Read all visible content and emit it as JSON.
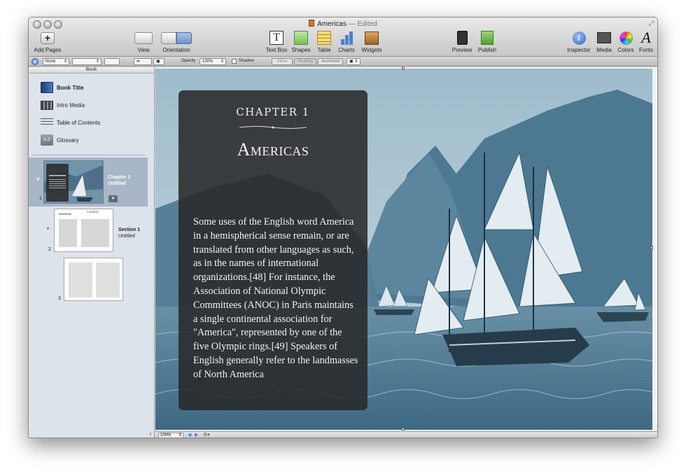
{
  "window": {
    "title": "Americas",
    "status": "— Edited"
  },
  "toolbar": {
    "add_pages": "Add Pages",
    "view": "View",
    "orientation": "Orientation",
    "text_box": "Text Box",
    "shapes": "Shapes",
    "table": "Table",
    "charts": "Charts",
    "widgets": "Widgets",
    "preview": "Preview",
    "publish": "Publish",
    "inspector": "Inspector",
    "media": "Media",
    "colors": "Colors",
    "fonts": "Fonts"
  },
  "format_bar": {
    "none_value": "None",
    "opacity_label": "Opacity",
    "opacity_value": "100%",
    "shadow_label": "Shadow",
    "inline": "Inline",
    "floating": "Floating",
    "anchored": "Anchored"
  },
  "sidebar": {
    "header": "Book",
    "items": [
      {
        "label": "Book Title",
        "icon": "book-icon"
      },
      {
        "label": "Intro Media",
        "icon": "film-icon"
      },
      {
        "label": "Table of Contents",
        "icon": "list-icon"
      },
      {
        "label": "Glossary",
        "icon": "az-icon",
        "icon_text": "A-Z"
      }
    ],
    "chapter": {
      "title": "Chapter 1",
      "subtitle": "Untitled",
      "number": "1"
    },
    "section": {
      "title": "Section 1",
      "subtitle": "Untitled",
      "number": "2",
      "thumb_title": "Untitled"
    },
    "page3_number": "3"
  },
  "page": {
    "chapter_label": "CHAPTER 1",
    "title": "Americas",
    "body": "Some uses of the English word America in a hemispherical sense remain, or are translated from other languages as such, as in the names of international organizations.[48] For instance, the Association of National Olympic Committees (ANOC) in Paris maintains a single continental association for \"America\", represented by one of the five Olympic rings.[49] Speakers of English generally refer to the landmasses of North America"
  },
  "bottom_bar": {
    "zoom": "100%"
  },
  "colors": {
    "accent": "#4a7fd0",
    "sidebar_selection": "#a8b6c8",
    "engraving_blue": "#5f8aa3"
  }
}
